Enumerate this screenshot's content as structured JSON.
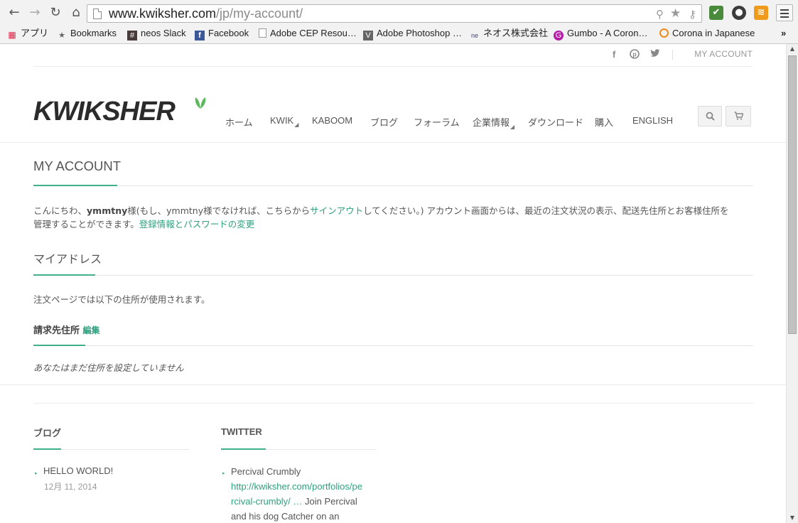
{
  "browser": {
    "url_host": "www.kwiksher.com",
    "url_path": "/jp/my-account/",
    "bookmarks": [
      {
        "label": "アプリ",
        "icon": "apps-grid-icon"
      },
      {
        "label": "Bookmarks",
        "icon": "star-icon"
      },
      {
        "label": "neos Slack",
        "icon": "slack-icon"
      },
      {
        "label": "Facebook",
        "icon": "facebook-icon"
      },
      {
        "label": "Adobe CEP Resou…",
        "icon": "page-icon"
      },
      {
        "label": "Adobe Photoshop …",
        "icon": "photoshop-icon"
      },
      {
        "label": "ネオス株式会社",
        "icon": "neos-icon"
      },
      {
        "label": "Gumbo - A Coron…",
        "icon": "gumbo-icon"
      },
      {
        "label": "Corona in Japanese",
        "icon": "corona-icon"
      }
    ],
    "overflow": "»"
  },
  "topbar": {
    "account_link": "MY ACCOUNT",
    "social": [
      "facebook-icon",
      "pinterest-icon",
      "twitter-icon"
    ]
  },
  "site": {
    "logo": "KWIKSHER",
    "nav": [
      "ホーム",
      "KWIK",
      "KABOOM",
      "ブログ",
      "フォーラム",
      "企業情報",
      "ダウンロード",
      "購入",
      "ENGLISH"
    ]
  },
  "account": {
    "title": "MY ACCOUNT",
    "greeting_prefix": "こんにちわ、",
    "username": "ymmtny",
    "greeting_mid": "様(もし、ymmtny様でなければ、こちらから",
    "signout_link": "サインアウト",
    "greeting_suffix": "してください。) アカウント画面からは、最近の注文状況の表示、配送先住所とお客様住所を",
    "line2_prefix": "管理することができます。",
    "edit_account_link": "登録情報とパスワードの変更",
    "address_title": "マイアドレス",
    "address_note": "注文ページでは以下の住所が使用されます。",
    "billing_title": "請求先住所",
    "billing_edit": "編集",
    "billing_empty": "あなたはまだ住所を設定していません"
  },
  "footer": {
    "blog_title": "ブログ",
    "blog_post_title": "HELLO WORLD!",
    "blog_post_date": "12月 11, 2014",
    "twitter_title": "TWITTER",
    "tweet_line1": "Percival Crumbly",
    "tweet_link_1": "http://kwiksher.com/portfolios/pe",
    "tweet_link_2": "rcival-crumbly/ …",
    "tweet_line3_suffix": " Join Percival",
    "tweet_line4": "and his dog Catcher on an"
  },
  "colors": {
    "accent": "#3fb08b",
    "link": "#2ea07e",
    "logo_leaf": "#5cb85c"
  }
}
